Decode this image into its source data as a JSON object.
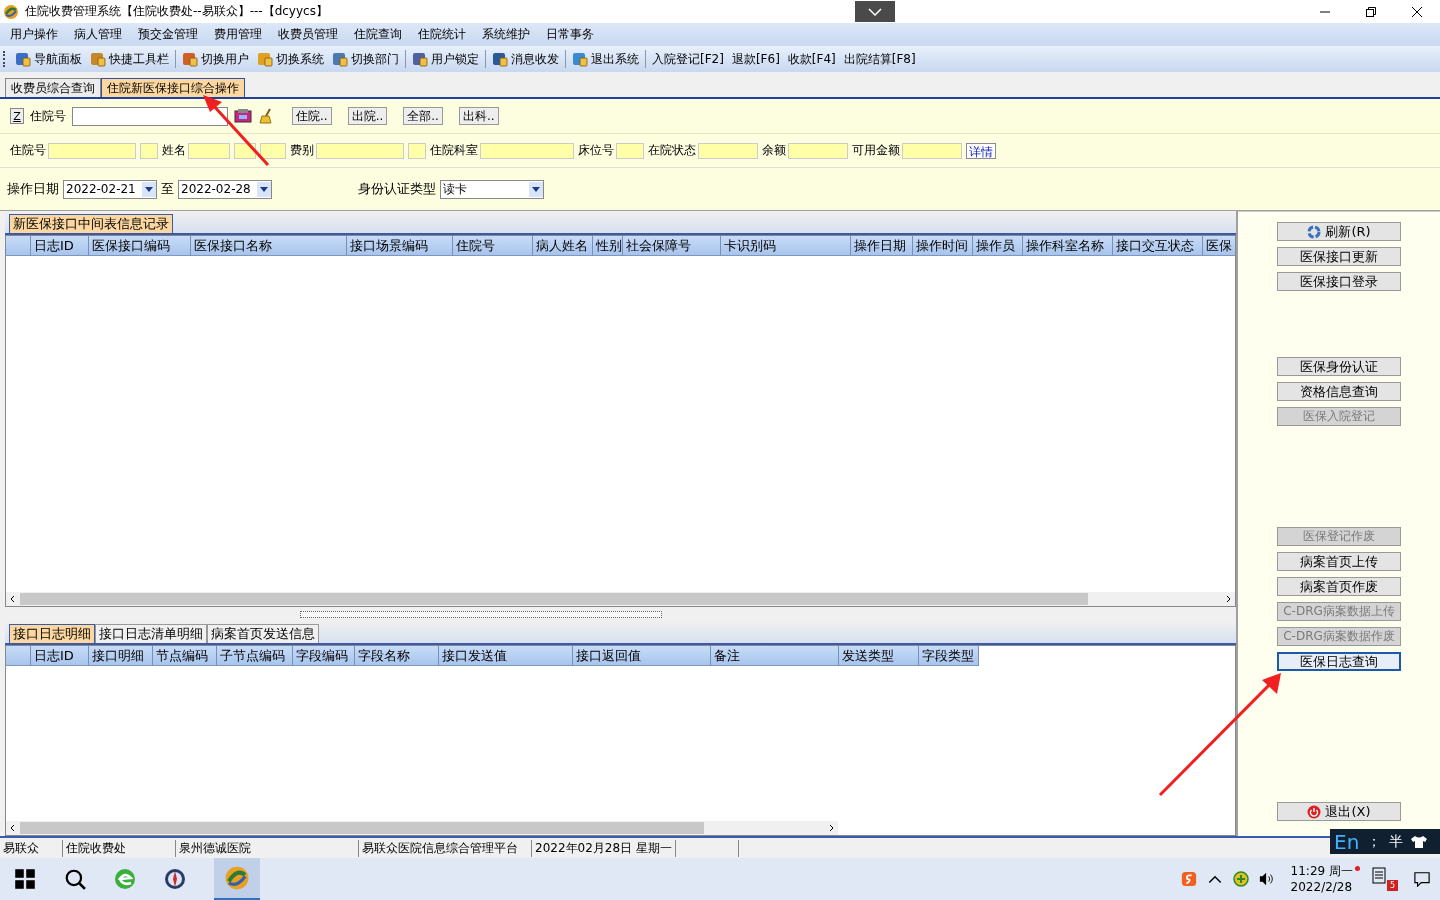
{
  "window": {
    "title": "住院收费管理系统【住院收费处--易联众】---【dcyycs】"
  },
  "menu": [
    "用户操作",
    "病人管理",
    "预交金管理",
    "费用管理",
    "收费员管理",
    "住院查询",
    "住院统计",
    "系统维护",
    "日常事务"
  ],
  "toolbar": [
    [
      {
        "label": "导航面板",
        "kind": "icon"
      },
      {
        "label": "快捷工具栏",
        "kind": "icon"
      }
    ],
    [
      {
        "label": "切换用户",
        "kind": "icon"
      },
      {
        "label": "切换系统",
        "kind": "icon"
      },
      {
        "label": "切换部门",
        "kind": "icon"
      }
    ],
    [
      {
        "label": "用户锁定",
        "kind": "icon"
      }
    ],
    [
      {
        "label": "消息收发",
        "kind": "icon"
      }
    ],
    [
      {
        "label": "退出系统",
        "kind": "icon"
      }
    ],
    [
      {
        "label": "入院登记[F2]",
        "kind": "text"
      },
      {
        "label": "退款[F6]",
        "kind": "text"
      },
      {
        "label": "收款[F4]",
        "kind": "text"
      },
      {
        "label": "出院结算[F8]",
        "kind": "text"
      }
    ]
  ],
  "tabs": [
    {
      "label": "收费员综合查询",
      "selected": false
    },
    {
      "label": "住院新医保接口综合操作",
      "selected": true
    }
  ],
  "search": {
    "z_button": "Z",
    "label": "住院号",
    "buttons": [
      "住院..",
      "出院..",
      "全部..",
      "出科.."
    ]
  },
  "patient_fields": [
    "住院号",
    "姓名",
    "费别",
    "住院科室",
    "床位号",
    "在院状态",
    "余额",
    "可用金额"
  ],
  "detail_button": "详情",
  "filters": {
    "date_label": "操作日期",
    "date_from": "2022-02-21",
    "to_label": "至",
    "date_to": "2022-02-28",
    "auth_label": "身份认证类型",
    "auth_value": "读卡"
  },
  "upper_grid": {
    "tabs": [
      {
        "label": "新医保接口中间表信息记录",
        "selected": true
      }
    ],
    "columns": [
      "日志ID",
      "医保接口编码",
      "医保接口名称",
      "接口场景编码",
      "住院号",
      "病人姓名",
      "性别",
      "社会保障号",
      "卡识别码",
      "操作日期",
      "操作时间",
      "操作员",
      "操作科室名称",
      "接口交互状态",
      "医保"
    ]
  },
  "lower_grid": {
    "tabs": [
      {
        "label": "接口日志明细",
        "selected": true
      },
      {
        "label": "接口日志清单明细",
        "selected": false
      },
      {
        "label": "病案首页发送信息",
        "selected": false
      }
    ],
    "columns": [
      "日志ID",
      "接口明细",
      "节点编码",
      "子节点编码",
      "字段编码",
      "字段名称",
      "接口发送值",
      "接口返回值",
      "备注",
      "发送类型",
      "字段类型"
    ]
  },
  "action_groups": [
    [
      {
        "label": "刷新(R)",
        "kind": "refresh",
        "disabled": false,
        "focused": false
      },
      {
        "label": "医保接口更新",
        "kind": "plain",
        "disabled": false,
        "focused": false
      },
      {
        "label": "医保接口登录",
        "kind": "plain",
        "disabled": false,
        "focused": false
      }
    ],
    [
      {
        "label": "医保身份认证",
        "kind": "plain",
        "disabled": false,
        "focused": false
      },
      {
        "label": "资格信息查询",
        "kind": "plain",
        "disabled": false,
        "focused": false
      },
      {
        "label": "医保入院登记",
        "kind": "plain",
        "disabled": true,
        "focused": false
      }
    ],
    [
      {
        "label": "医保登记作废",
        "kind": "plain",
        "disabled": true,
        "focused": false
      },
      {
        "label": "病案首页上传",
        "kind": "plain",
        "disabled": false,
        "focused": false
      },
      {
        "label": "病案首页作废",
        "kind": "plain",
        "disabled": false,
        "focused": false
      },
      {
        "label": "C-DRG病案数据上传",
        "kind": "plain",
        "disabled": true,
        "focused": false
      },
      {
        "label": "C-DRG病案数据作废",
        "kind": "plain",
        "disabled": true,
        "focused": false
      },
      {
        "label": "医保日志查询",
        "kind": "plain",
        "disabled": false,
        "focused": true
      }
    ],
    [
      {
        "label": "退出(X)",
        "kind": "exit",
        "disabled": false,
        "focused": false
      }
    ]
  ],
  "status_bar": [
    "易联众",
    "住院收费处",
    "泉州德诚医院",
    "易联众医院信息综合管理平台",
    "2022年02月28日 星期一"
  ],
  "ime": {
    "mode": "En",
    "punct": "；",
    "width": "半"
  },
  "taskbar": {
    "time": "11:29 周一",
    "date": "2022/2/28",
    "notifications": "5"
  }
}
